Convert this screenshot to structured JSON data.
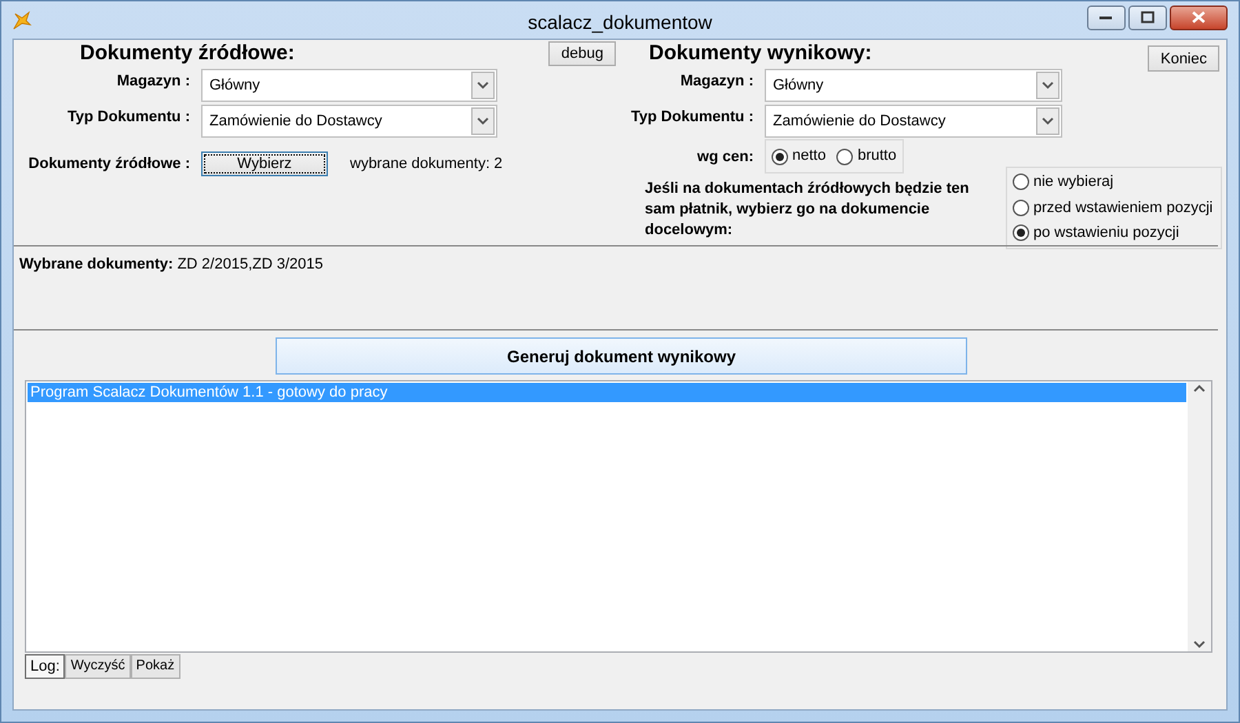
{
  "window": {
    "title": "scalacz_dokumentow"
  },
  "source": {
    "heading": "Dokumenty źródłowe:",
    "debug_button": "debug",
    "fields": [
      {
        "label": "Magazyn :",
        "value": "Główny"
      },
      {
        "label": "Typ Dokumentu :",
        "value": "Zamówienie do Dostawcy"
      }
    ],
    "picker": {
      "label": "Dokumenty źródłowe :",
      "button": "Wybierz",
      "count": "wybrane dokumenty: 2"
    }
  },
  "target": {
    "heading": "Dokumenty wynikowy:",
    "close_button": "Koniec",
    "fields": [
      {
        "label": "Magazyn :",
        "value": "Główny"
      },
      {
        "label": "Typ Dokumentu :",
        "value": "Zamówienie do Dostawcy"
      }
    ],
    "price": {
      "label": "wg cen:",
      "options": [
        {
          "label": "netto",
          "selected": true
        },
        {
          "label": "brutto",
          "selected": false
        }
      ]
    },
    "payer": {
      "text": "Jeśli na dokumentach źródłowych będzie ten sam płatnik, wybierz go na dokumencie docelowym:",
      "options": [
        {
          "label": "nie wybieraj",
          "selected": false
        },
        {
          "label": "przed wstawieniem pozycji",
          "selected": false
        },
        {
          "label": "po wstawieniu pozycji",
          "selected": true
        }
      ]
    }
  },
  "selected_documents": "**Wybrane dokumenty:** ZD 2/2015,ZD 3/2015",
  "generate_button": "Generuj dokument wynikowy",
  "log": {
    "items": [
      {
        "text": "Program Scalacz Dokumentów 1.1 - gotowy do pracy",
        "selected": true
      }
    ],
    "tabs": [
      {
        "label": "Log:",
        "selected": true
      },
      {
        "label": "Wyczyść",
        "selected": false
      },
      {
        "label": "Pokaż",
        "selected": false
      }
    ]
  }
}
